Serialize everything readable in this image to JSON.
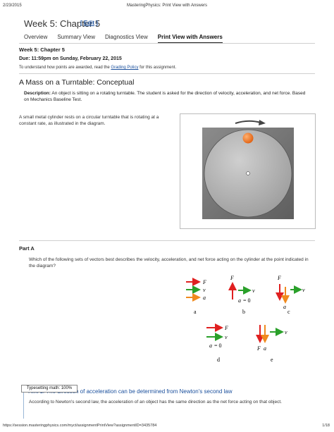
{
  "print_header": {
    "date": "2/23/2015",
    "title": "MasteringPhysics: Print View with Answers"
  },
  "page": {
    "title": "Week 5: Chapter 5",
    "edit_label": "Edit",
    "edit_open": "[",
    "edit_close": "]"
  },
  "tabs": [
    {
      "label": "Overview"
    },
    {
      "label": "Summary View"
    },
    {
      "label": "Diagnostics View"
    },
    {
      "label": "Print View with Answers"
    }
  ],
  "assignment": {
    "heading": "Week 5: Chapter 5",
    "due": "Due: 11:59pm on Sunday, February 22, 2015",
    "info_pre": "To understand how points are awarded, read the ",
    "info_link": "Grading Policy",
    "info_post": " for this assignment."
  },
  "problem": {
    "title": "A Mass on a Turntable: Conceptual",
    "desc_label": "Description:",
    "desc_text": " An object is sitting on a rotating turntable. The student is asked for the direction of velocity, acceleration, and net force. Based on Mechanics Baseline Test.",
    "body": "A small metal cylinder rests on a circular turntable that is rotating at a constant rate, as illustrated in the diagram."
  },
  "part_a": {
    "label": "Part A",
    "question": "Which of the following sets of vectors best describes the velocity, acceleration, and net force acting on the cylinder at the point indicated in the diagram?",
    "choices": [
      "a",
      "b",
      "c",
      "d",
      "e"
    ],
    "vec_F": "F",
    "vec_v": "v",
    "vec_a": "a",
    "eq_zero": "= 0"
  },
  "typesetting": "Typesetting math: 100%",
  "hint": {
    "title": "Hint 1. The direction of acceleration can be determined from Newton's second law",
    "body": "According to Newton's second law, the acceleration of an object has the same direction as the net force acting on that object."
  },
  "footer": {
    "url": "https://session.masteringphysics.com/myct/assignmentPrintView?assignmentID=3435784",
    "page": "1/18"
  },
  "colors": {
    "red": "#e02020",
    "green": "#2aa02a",
    "orange": "#f08a1e",
    "link": "#1a4f9c"
  }
}
